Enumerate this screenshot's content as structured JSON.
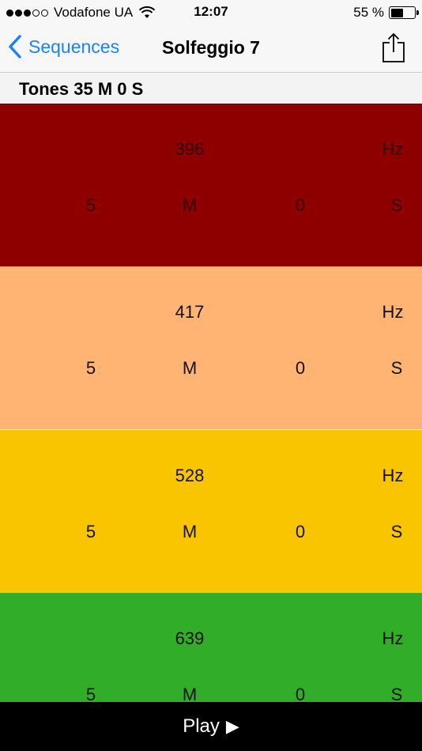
{
  "status_bar": {
    "carrier": "Vodafone UA",
    "time": "12:07",
    "battery_percent": "55 %",
    "battery_level": 0.55,
    "signal_bars_filled": 3,
    "signal_bars_total": 5
  },
  "nav": {
    "back_label": "Sequences",
    "title": "Solfeggio 7",
    "accent_color": "#1a82fb"
  },
  "summary": {
    "text": "Tones 35 M 0 S"
  },
  "tones": [
    {
      "frequency": "396",
      "freq_unit": "Hz",
      "minutes": "5",
      "min_unit": "M",
      "seconds": "0",
      "sec_unit": "S",
      "color": "#8e0000",
      "text_color": "#300000"
    },
    {
      "frequency": "417",
      "freq_unit": "Hz",
      "minutes": "5",
      "min_unit": "M",
      "seconds": "0",
      "sec_unit": "S",
      "color": "#ffb473",
      "text_color": "#111111"
    },
    {
      "frequency": "528",
      "freq_unit": "Hz",
      "minutes": "5",
      "min_unit": "M",
      "seconds": "0",
      "sec_unit": "S",
      "color": "#f9c500",
      "text_color": "#111111"
    },
    {
      "frequency": "639",
      "freq_unit": "Hz",
      "minutes": "5",
      "min_unit": "M",
      "seconds": "0",
      "sec_unit": "S",
      "color": "#32ad2a",
      "text_color": "#111111"
    }
  ],
  "play": {
    "label": "Play",
    "icon": "▶"
  }
}
